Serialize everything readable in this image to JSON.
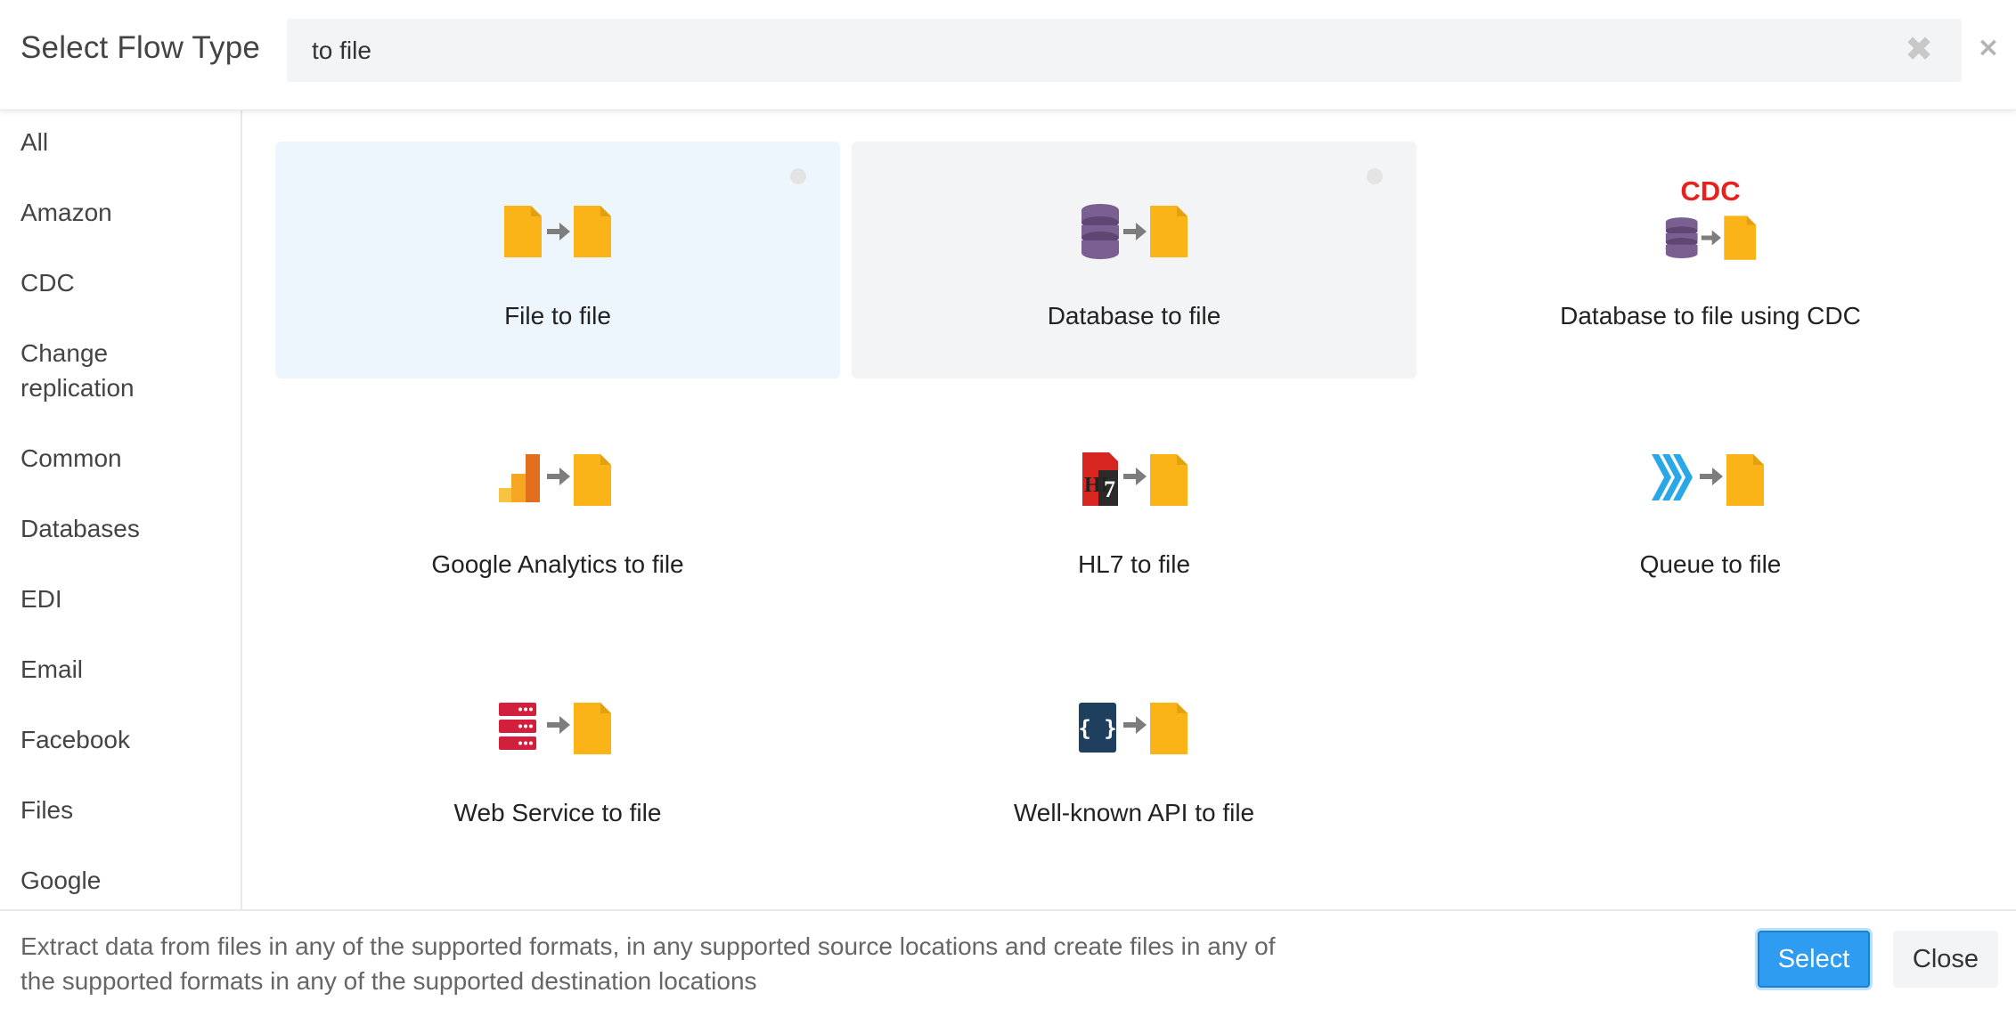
{
  "header": {
    "title": "Select Flow Type",
    "search_value": "to file",
    "search_clear_glyph": "✖",
    "close_glyph": "×"
  },
  "sidebar": {
    "items": [
      {
        "label": "All"
      },
      {
        "label": "Amazon"
      },
      {
        "label": "CDC"
      },
      {
        "label": "Change replication"
      },
      {
        "label": "Common"
      },
      {
        "label": "Databases"
      },
      {
        "label": "EDI"
      },
      {
        "label": "Email"
      },
      {
        "label": "Facebook"
      },
      {
        "label": "Files"
      },
      {
        "label": "Google"
      }
    ]
  },
  "tiles": [
    {
      "label": "File to file",
      "icon": "file-to-file-icon",
      "state": "selected"
    },
    {
      "label": "Database to file",
      "icon": "database-to-file-icon",
      "state": "hover"
    },
    {
      "label": "Database to file using CDC",
      "icon": "database-cdc-to-file-icon",
      "badge": "CDC"
    },
    {
      "label": "Google Analytics to file",
      "icon": "google-analytics-to-file-icon"
    },
    {
      "label": "HL7 to file",
      "icon": "hl7-to-file-icon",
      "icon_text": "HL7"
    },
    {
      "label": "Queue to file",
      "icon": "queue-to-file-icon"
    },
    {
      "label": "Web Service to file",
      "icon": "web-service-to-file-icon"
    },
    {
      "label": "Well-known API to file",
      "icon": "api-to-file-icon",
      "icon_text": "{ }"
    }
  ],
  "footer": {
    "description": "Extract data from files in any of the supported formats, in any supported source locations and create files in any of the supported formats in any of the supported destination locations",
    "select_label": "Select",
    "close_label": "Close"
  },
  "colors": {
    "file": "#fbb418",
    "file_fold": "#e3a00f",
    "arrow": "#7d7d7d",
    "database": "#7b5f93",
    "cdc": "#e8211f",
    "ga_orange": "#f6a623",
    "ga_dark": "#e36f1e",
    "hl7_red": "#d7261f",
    "queue": "#2aa7e6",
    "web_service": "#d21f3c",
    "api": "#1e3f5e",
    "select_button": "#2e9cf0"
  }
}
